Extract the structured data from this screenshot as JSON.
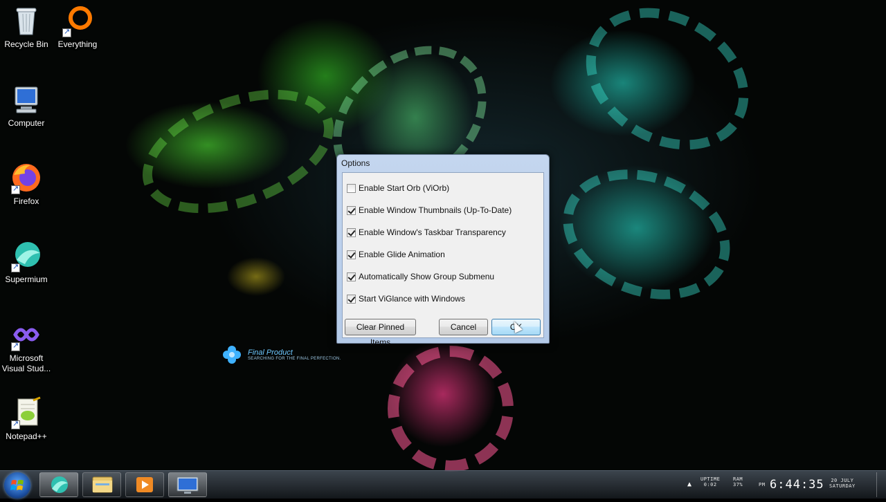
{
  "desktop": {
    "icons": [
      {
        "label": "Recycle Bin",
        "icon": "recycle-bin-icon"
      },
      {
        "label": "Everything",
        "icon": "everything-icon"
      },
      {
        "label": "Computer",
        "icon": "computer-icon"
      },
      {
        "label": "Firefox",
        "icon": "firefox-icon"
      },
      {
        "label": "Supermium",
        "icon": "supermium-icon"
      },
      {
        "label": "Microsoft Visual Stud...",
        "icon": "visual-studio-icon"
      },
      {
        "label": "Notepad++",
        "icon": "notepad-plus-plus-icon"
      }
    ],
    "logo": {
      "title": "Final Product",
      "tagline": "SEARCHING FOR THE FINAL PERFECTION."
    }
  },
  "dialog": {
    "title": "Options",
    "options": [
      {
        "label": "Enable Start Orb (ViOrb)",
        "checked": false
      },
      {
        "label": "Enable Window Thumbnails (Up-To-Date)",
        "checked": true
      },
      {
        "label": "Enable Window's Taskbar Transparency",
        "checked": true
      },
      {
        "label": "Enable Glide Animation",
        "checked": true
      },
      {
        "label": "Automatically Show Group Submenu",
        "checked": true
      },
      {
        "label": "Start ViGlance with Windows",
        "checked": true
      }
    ],
    "buttons": {
      "clear": "Clear Pinned Items",
      "cancel": "Cancel",
      "ok": "OK"
    }
  },
  "taskbar": {
    "apps": [
      "supermium-icon",
      "file-explorer-icon",
      "media-player-icon",
      "remote-desktop-icon"
    ],
    "tray": {
      "uptime_label": "UPTIME",
      "uptime_value": "0:02",
      "ram_label": "RAM",
      "ram_value": "37%",
      "ampm": "PM",
      "time": "6:44:35",
      "date": "20 JULY",
      "weekday": "SATURDAY"
    }
  },
  "colors": {
    "dialog_frame": "#c4d6ef",
    "button_focus": "#bee6fd"
  }
}
